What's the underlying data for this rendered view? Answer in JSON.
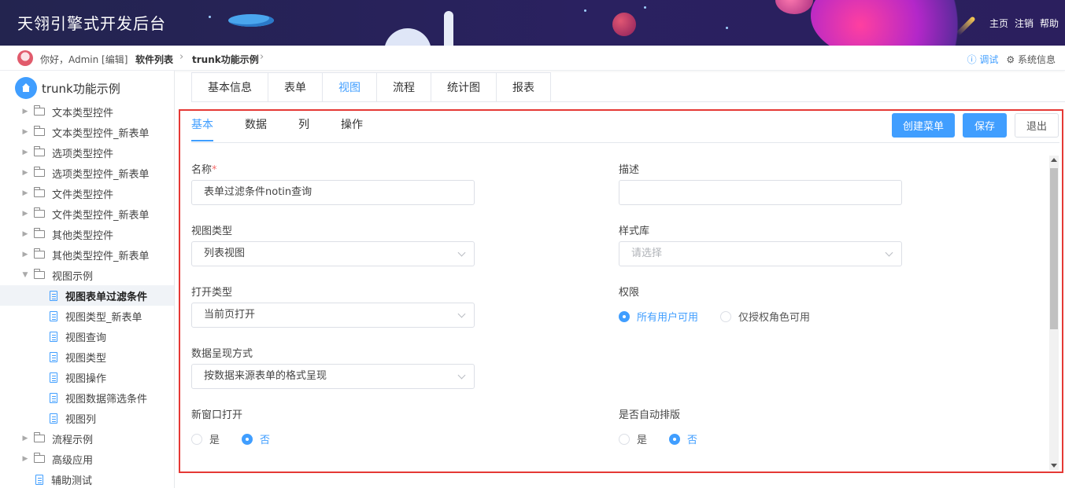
{
  "header": {
    "title": "天翎引擎式开发后台",
    "links": [
      "主页",
      "注销",
      "帮助"
    ]
  },
  "crumbbar": {
    "greeting": "你好，Admin [编辑]",
    "crumbs": [
      "软件列表",
      "trunk功能示例"
    ],
    "debug": "ⓘ 调试",
    "system_info": "⚙ 系统信息"
  },
  "sidebar": {
    "root": "trunk功能示例",
    "items": [
      {
        "label": "文本类型控件",
        "type": "folder"
      },
      {
        "label": "文本类型控件_新表单",
        "type": "folder"
      },
      {
        "label": "选项类型控件",
        "type": "folder"
      },
      {
        "label": "选项类型控件_新表单",
        "type": "folder"
      },
      {
        "label": "文件类型控件",
        "type": "folder"
      },
      {
        "label": "文件类型控件_新表单",
        "type": "folder"
      },
      {
        "label": "其他类型控件",
        "type": "folder"
      },
      {
        "label": "其他类型控件_新表单",
        "type": "folder"
      },
      {
        "label": "视图示例",
        "type": "folder-open"
      },
      {
        "label": "视图表单过滤条件",
        "type": "child",
        "active": true
      },
      {
        "label": "视图类型_新表单",
        "type": "child"
      },
      {
        "label": "视图查询",
        "type": "child"
      },
      {
        "label": "视图类型",
        "type": "child"
      },
      {
        "label": "视图操作",
        "type": "child"
      },
      {
        "label": "视图数据筛选条件",
        "type": "child"
      },
      {
        "label": "视图列",
        "type": "child"
      },
      {
        "label": "流程示例",
        "type": "folder"
      },
      {
        "label": "高级应用",
        "type": "folder"
      },
      {
        "label": "辅助测试",
        "type": "leaf"
      }
    ]
  },
  "top_tabs": [
    "基本信息",
    "表单",
    "视图",
    "流程",
    "统计图",
    "报表"
  ],
  "sub_tabs": [
    "基本",
    "数据",
    "列",
    "操作"
  ],
  "buttons": {
    "create_menu": "创建菜单",
    "save": "保存",
    "exit": "退出"
  },
  "form": {
    "name_label": "名称",
    "required_mark": "*",
    "name_value": "表单过滤条件notin查询",
    "desc_label": "描述",
    "desc_value": "",
    "view_type_label": "视图类型",
    "view_type_value": "列表视图",
    "style_lib_label": "样式库",
    "style_lib_placeholder": "请选择",
    "open_type_label": "打开类型",
    "open_type_value": "当前页打开",
    "permission_label": "权限",
    "permission_options": [
      "所有用户可用",
      "仅授权角色可用"
    ],
    "present_label": "数据呈现方式",
    "present_value": "按数据来源表单的格式呈现",
    "new_window_label": "新窗口打开",
    "auto_layout_label": "是否自动排版",
    "yes": "是",
    "no": "否"
  },
  "colors": {
    "accent": "#409eff",
    "highlight_border": "#e53935",
    "header_bg": "#23244f"
  }
}
